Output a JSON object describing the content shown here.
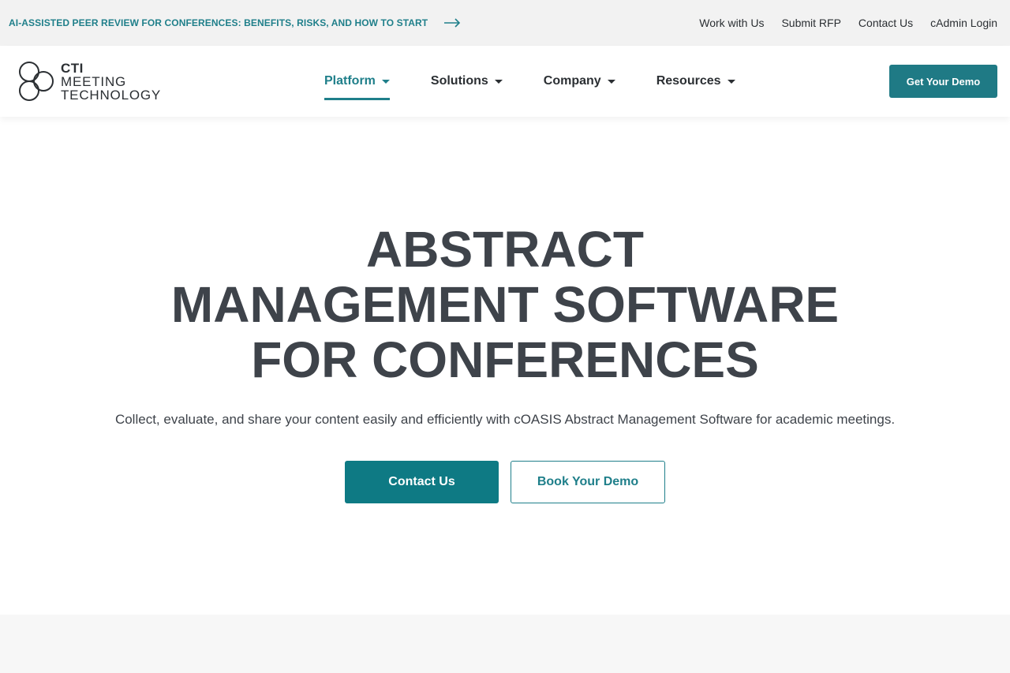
{
  "topbar": {
    "announcement": "AI-ASSISTED PEER REVIEW FOR CONFERENCES: BENEFITS, RISKS, AND HOW TO START",
    "arrow_icon": "arrow-right-icon",
    "links": [
      "Work with Us",
      "Submit RFP",
      "Contact Us",
      "cAdmin Login"
    ]
  },
  "logo": {
    "line1": "CTI",
    "line2": "MEETING",
    "line3": "TECHNOLOGY"
  },
  "nav": {
    "items": [
      {
        "label": "Platform",
        "active": true
      },
      {
        "label": "Solutions",
        "active": false
      },
      {
        "label": "Company",
        "active": false
      },
      {
        "label": "Resources",
        "active": false
      }
    ],
    "demo_label": "Get Your Demo"
  },
  "hero": {
    "title_line1": "ABSTRACT",
    "title_line2": "MANAGEMENT SOFTWARE",
    "title_line3": "FOR CONFERENCES",
    "subtitle": "Collect, evaluate, and share your content easily and efficiently with cOASIS Abstract Management Software for academic meetings.",
    "primary_cta": "Contact Us",
    "secondary_cta": "Book Your Demo"
  },
  "colors": {
    "brand_teal": "#1f7f8a",
    "button_teal": "#0e7a84",
    "text_dark": "#3e434a",
    "topbar_bg": "#f2f2f2"
  }
}
